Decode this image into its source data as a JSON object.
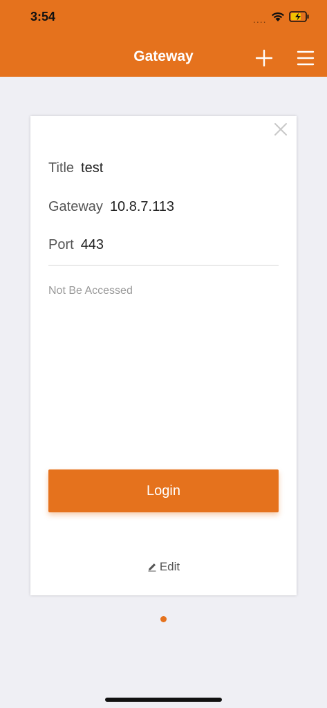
{
  "status_bar": {
    "time": "3:54",
    "signal": "....",
    "wifi_icon": "wifi-icon",
    "battery_icon": "battery-charging-icon"
  },
  "nav": {
    "title": "Gateway",
    "add_icon": "plus-icon",
    "menu_icon": "hamburger-menu-icon"
  },
  "card": {
    "close_icon": "close-icon",
    "fields": [
      {
        "label": "Title",
        "value": "test"
      },
      {
        "label": "Gateway",
        "value": "10.8.7.113"
      },
      {
        "label": "Port",
        "value": "443"
      }
    ],
    "status": "Not Be Accessed",
    "login_label": "Login",
    "edit_label": "Edit",
    "edit_icon": "pencil-icon"
  },
  "pagination": {
    "current": 1,
    "total": 1
  },
  "colors": {
    "accent": "#e5721d",
    "background": "#efeff4",
    "card": "#ffffff"
  }
}
